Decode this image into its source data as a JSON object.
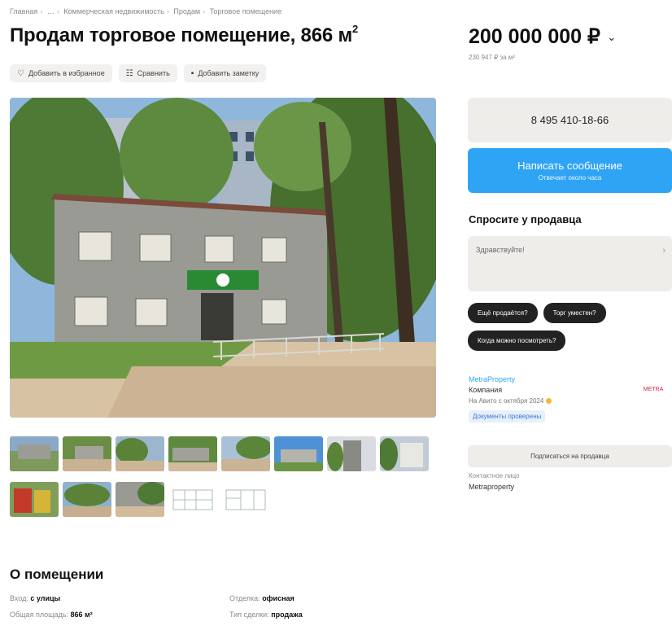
{
  "breadcrumb": [
    "Главная",
    "…",
    "Коммерческая недвижимость",
    "Продам",
    "Торговое помещение"
  ],
  "title": {
    "text": "Продам торговое помещение, 866 м",
    "sup": "2"
  },
  "actions": {
    "favorite": "Добавить в избранное",
    "compare": "Сравнить",
    "note": "Добавить заметку"
  },
  "price": {
    "value": "200 000 000 ₽",
    "per_m2": "230 947 ₽ за м²"
  },
  "contact": {
    "phone": "8 495 410-18-66",
    "message_label": "Написать сообщение",
    "message_sub": "Отвечает около часа"
  },
  "ask": {
    "title": "Спросите у продавца",
    "placeholder": "Здравствуйте!",
    "chips": [
      "Ещё продаётся?",
      "Торг уместен?",
      "Когда можно посмотреть?"
    ]
  },
  "seller": {
    "name": "MetraProperty",
    "type": "Компания",
    "since": "На Авито с октября 2024",
    "docs": "Документы проверены",
    "logo": "METRA",
    "subscribe": "Подписаться на продавца",
    "contact_label": "Контактное лицо",
    "contact_name": "Metraproperty"
  },
  "about": {
    "title": "О помещении",
    "props": [
      {
        "k": "Вход: ",
        "v": "с улицы"
      },
      {
        "k": "Отделка: ",
        "v": "офисная"
      },
      {
        "k": "Общая площадь: ",
        "v": "866 м²"
      },
      {
        "k": "Тип сделки: ",
        "v": "продажа"
      }
    ]
  },
  "colors": {
    "accent": "#2fa4f5",
    "chip": "#222222",
    "panel": "#efedea"
  }
}
